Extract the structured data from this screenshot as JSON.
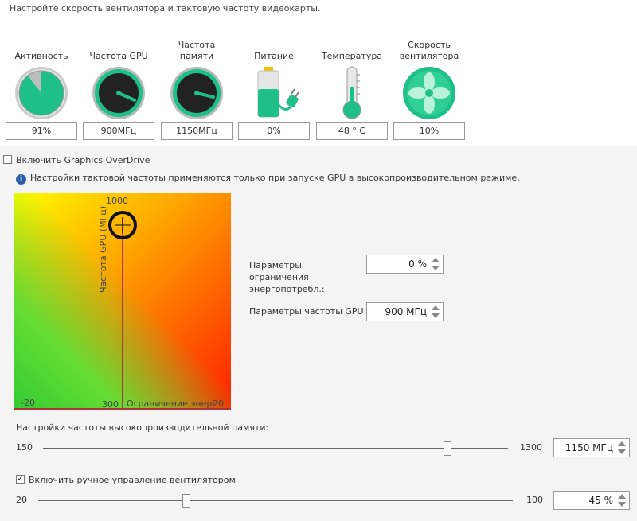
{
  "header": {
    "title": "Настройте скорость вентилятора и тактовую частоту видеокарты."
  },
  "gauges": [
    {
      "label": "Активность",
      "value": "91%",
      "icon": "activity-gauge-icon"
    },
    {
      "label": "Частота GPU",
      "value": "900МГц",
      "icon": "gpu-clock-gauge-icon"
    },
    {
      "label": "Частота памяти",
      "value": "1150МГц",
      "icon": "memory-clock-gauge-icon"
    },
    {
      "label": "Питание",
      "value": "0%",
      "icon": "battery-plug-icon"
    },
    {
      "label": "Температура",
      "value": "48 ° C",
      "icon": "thermometer-icon"
    },
    {
      "label": "Скорость вентилятора",
      "value": "10%",
      "icon": "fan-icon"
    }
  ],
  "overdrive": {
    "enable_label": "Включить Graphics OverDrive",
    "checked": false
  },
  "notice": {
    "text": "Настройки тактовой частоты применяются только при запуске GPU в высокопроизводительном режиме."
  },
  "graph": {
    "y_top": "1000",
    "y_bottom": "300",
    "x_left": "-20",
    "x_right": "20",
    "ylabel": "Частота GPU (МГц)",
    "xlabel": "Ограничение энерг"
  },
  "power_limit": {
    "label": "Параметры ограничения энергопотребл.:",
    "value": "0 %"
  },
  "gpu_clock": {
    "label": "Параметры частоты GPU:",
    "value": "900 МГц"
  },
  "memory": {
    "label": "Настройки частоты высокопроизводительной памяти:",
    "min": "150",
    "max": "1300",
    "value": "1150 МГц",
    "level": 1150
  },
  "fan": {
    "enable_label": "Включить ручное управление вентилятором",
    "checked": true,
    "min": "20",
    "max": "100",
    "value": "45 %",
    "level": 45
  }
}
